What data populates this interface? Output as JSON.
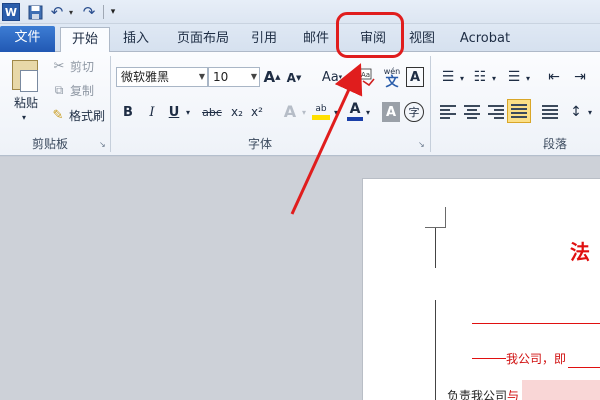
{
  "qat": {
    "app_letter": "W",
    "icons": [
      "word-logo-icon",
      "save-icon",
      "undo-icon",
      "redo-icon",
      "customize-qat-icon"
    ]
  },
  "tabs": {
    "file": "文件",
    "home": "开始",
    "insert": "插入",
    "layout": "页面布局",
    "references": "引用",
    "mailings": "邮件",
    "review": "审阅",
    "view": "视图",
    "acrobat": "Acrobat"
  },
  "clipboard": {
    "paste": "粘贴",
    "cut": "剪切",
    "copy": "复制",
    "format_painter": "格式刷",
    "group_label": "剪贴板"
  },
  "font": {
    "font_name": "微软雅黑",
    "font_size": "10",
    "grow_glyph": "A",
    "shrink_glyph": "A",
    "case_glyph": "Aa",
    "phonetic_glyph": "wén",
    "phonetic_char": "文",
    "border_glyph": "A",
    "bold": "B",
    "italic": "I",
    "underline": "U",
    "strike": "abc",
    "subscript": "x₂",
    "superscript": "x²",
    "highlight": "ab",
    "font_color": "A",
    "shading": "A",
    "enclose": "字",
    "group_label": "字体"
  },
  "paragraph": {
    "group_label": "段落"
  },
  "document": {
    "title_char": "法",
    "red_line": "我公司，即",
    "body_prefix": "负责我公司",
    "body_insert": "与"
  },
  "colors": {
    "annotation_red": "#e01d1d",
    "file_tab_blue": "#2a5dab",
    "highlight_yellow": "#ffe000"
  }
}
